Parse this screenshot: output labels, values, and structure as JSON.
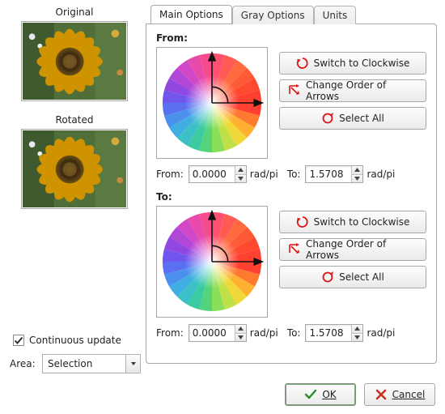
{
  "left": {
    "original_label": "Original",
    "rotated_label": "Rotated",
    "continuous_update_label": "Continuous update",
    "continuous_update_checked": true,
    "area_label": "Area:",
    "area_value": "Selection"
  },
  "tabs": {
    "main": "Main Options",
    "gray": "Gray Options",
    "units": "Units"
  },
  "section_from": {
    "title": "From:",
    "buttons": {
      "switch_clockwise": "Switch to Clockwise",
      "change_order": "Change Order of Arrows",
      "select_all": "Select All"
    },
    "from_label": "From:",
    "from_value": "0.0000",
    "to_label": "To:",
    "to_value": "1.5708",
    "unit": "rad/pi"
  },
  "section_to": {
    "title": "To:",
    "buttons": {
      "switch_clockwise": "Switch to Clockwise",
      "change_order": "Change Order of Arrows",
      "select_all": "Select All"
    },
    "from_label": "From:",
    "from_value": "0.0000",
    "to_label": "To:",
    "to_value": "1.5708",
    "unit": "rad/pi"
  },
  "dialog": {
    "ok": "OK",
    "cancel": "Cancel"
  }
}
